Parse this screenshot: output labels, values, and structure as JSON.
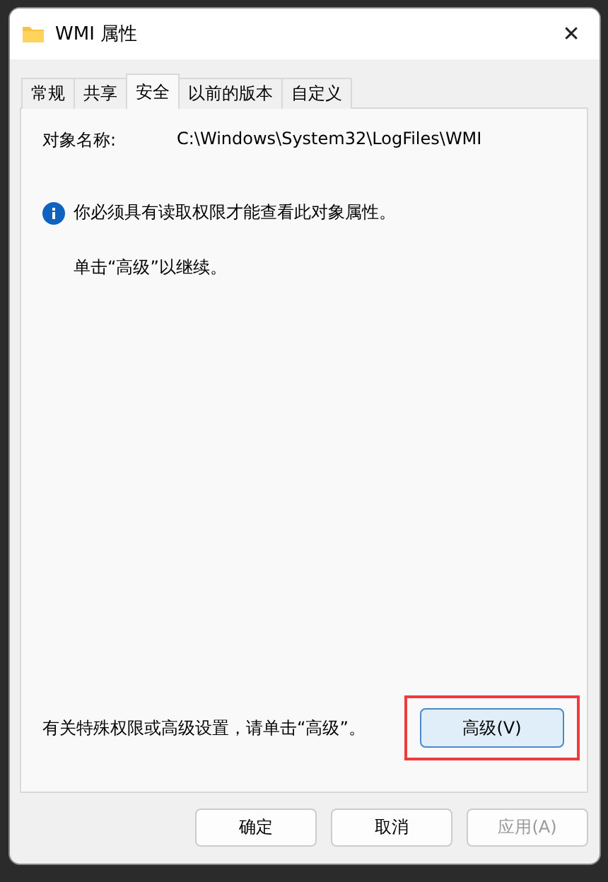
{
  "window": {
    "title": "WMI 属性",
    "close": "✕"
  },
  "tabs": [
    {
      "label": "常规",
      "selected": false
    },
    {
      "label": "共享",
      "selected": false
    },
    {
      "label": "安全",
      "selected": true
    },
    {
      "label": "以前的版本",
      "selected": false
    },
    {
      "label": "自定义",
      "selected": false
    }
  ],
  "object_name": {
    "label": "对象名称:",
    "value": "C:\\Windows\\System32\\LogFiles\\WMI"
  },
  "notice": {
    "message": "你必须具有读取权限才能查看此对象属性。",
    "hint": "单击“高级”以继续。"
  },
  "advanced": {
    "text": "有关特殊权限或高级设置，请单击“高级”。",
    "button": "高级(V)",
    "highlighted": true
  },
  "buttons": [
    {
      "label": "确定",
      "disabled": false
    },
    {
      "label": "取消",
      "disabled": false
    },
    {
      "label": "应用(A)",
      "disabled": true
    }
  ]
}
